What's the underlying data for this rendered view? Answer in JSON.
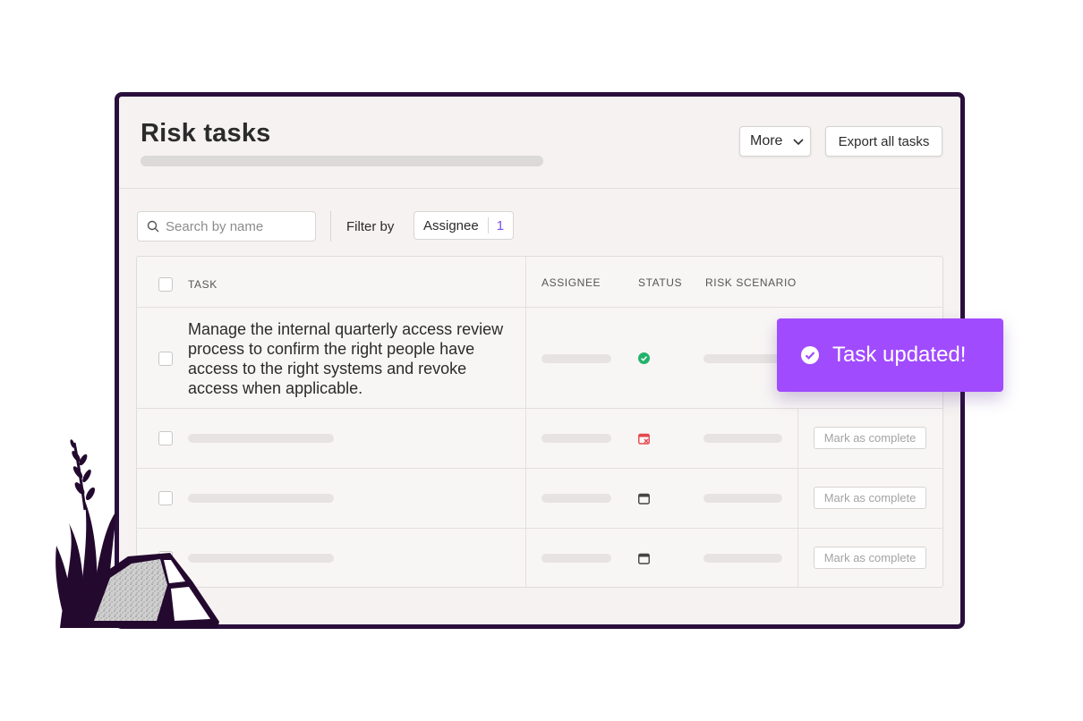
{
  "page": {
    "title": "Risk tasks"
  },
  "toolbar": {
    "more_label": "More",
    "export_label": "Export all tasks"
  },
  "filters": {
    "search_placeholder": "Search by name",
    "filter_by_label": "Filter by",
    "assignee_chip": {
      "label": "Assignee",
      "count": "1"
    }
  },
  "table": {
    "columns": {
      "task": "TASK",
      "assignee": "ASSIGNEE",
      "status": "STATUS",
      "risk_scenario": "RISK SCENARIO"
    },
    "rows": [
      {
        "task": "Manage the internal quarterly access review process to confirm the right people have access to the right systems and revoke access when applicable.",
        "status_icon": "check-circle-icon",
        "action": ""
      },
      {
        "task": "",
        "status_icon": "calendar-overdue-icon",
        "action": "Mark as complete"
      },
      {
        "task": "",
        "status_icon": "calendar-icon",
        "action": "Mark as complete"
      },
      {
        "task": "",
        "status_icon": "calendar-icon",
        "action": "Mark as complete"
      }
    ]
  },
  "toast": {
    "message": "Task updated!",
    "icon": "check-circle-icon"
  },
  "colors": {
    "frame_border": "#2a0f3d",
    "toast_bg": "#a14bff",
    "accent": "#7a4cf0",
    "status_done": "#22b36b",
    "status_overdue": "#e5484d"
  }
}
